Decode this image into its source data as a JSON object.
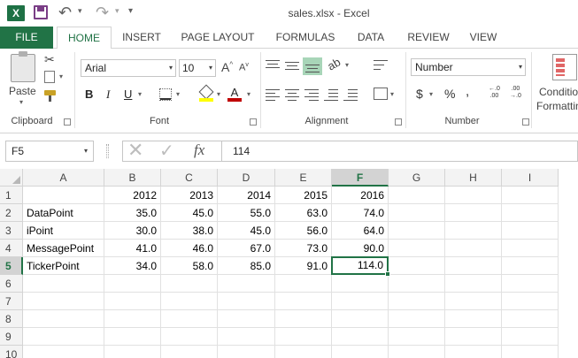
{
  "app": {
    "logo": "X",
    "title": "sales.xlsx - Excel"
  },
  "tabs": [
    {
      "id": "file",
      "label": "FILE"
    },
    {
      "id": "home",
      "label": "HOME"
    },
    {
      "id": "insert",
      "label": "INSERT"
    },
    {
      "id": "page",
      "label": "PAGE LAYOUT"
    },
    {
      "id": "formulas",
      "label": "FORMULAS"
    },
    {
      "id": "data",
      "label": "DATA"
    },
    {
      "id": "review",
      "label": "REVIEW"
    },
    {
      "id": "view",
      "label": "VIEW"
    }
  ],
  "ribbon": {
    "clipboard": {
      "paste_label": "Paste",
      "group_label": "Clipboard"
    },
    "font": {
      "name": "Arial",
      "size": "10",
      "group_label": "Font",
      "bold": "B",
      "italic": "I",
      "underline": "U",
      "grow": "A",
      "shrink": "A",
      "font_color_glyph": "A"
    },
    "alignment": {
      "group_label": "Alignment"
    },
    "number": {
      "format": "Number",
      "group_label": "Number",
      "currency": "$",
      "percent": "%",
      "comma": ",",
      "inc_decimal": "←.0\n.00",
      "dec_decimal": ".00\n→.0"
    },
    "styles": {
      "cond_label_1": "Conditio",
      "cond_label_2": "Formattin"
    }
  },
  "formula_bar": {
    "name_box": "F5",
    "cancel": "✕",
    "enter": "✓",
    "fx": "fx",
    "value": "114"
  },
  "sheet": {
    "columns": [
      "A",
      "B",
      "C",
      "D",
      "E",
      "F",
      "G",
      "H",
      "I"
    ],
    "rows": [
      "1",
      "2",
      "3",
      "4",
      "5",
      "6",
      "7",
      "8",
      "9",
      "10"
    ],
    "selected_cell": "F5",
    "cells": [
      [
        "",
        "2012",
        "2013",
        "2014",
        "2015",
        "2016",
        "",
        "",
        ""
      ],
      [
        "DataPoint",
        "35.0",
        "45.0",
        "55.0",
        "63.0",
        "74.0",
        "",
        "",
        ""
      ],
      [
        "iPoint",
        "30.0",
        "38.0",
        "45.0",
        "56.0",
        "64.0",
        "",
        "",
        ""
      ],
      [
        "MessagePoint",
        "41.0",
        "46.0",
        "67.0",
        "73.0",
        "90.0",
        "",
        "",
        ""
      ],
      [
        "TickerPoint",
        "34.0",
        "58.0",
        "85.0",
        "91.0",
        "114.0",
        "",
        "",
        ""
      ]
    ]
  },
  "colors": {
    "excel_green": "#217346",
    "selection_green": "#217346"
  }
}
